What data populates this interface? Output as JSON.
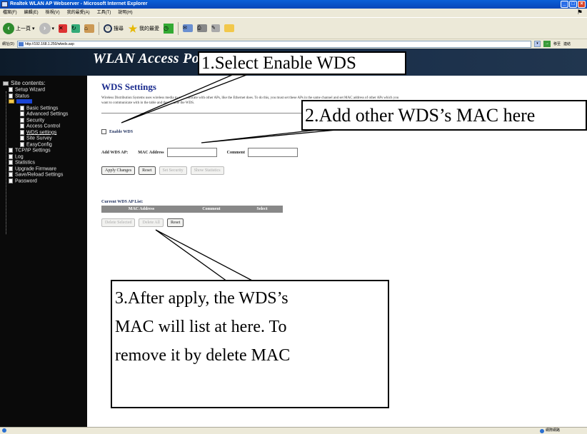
{
  "window": {
    "title": "Realtek WLAN AP Webserver - Microsoft Internet Explorer",
    "controls": {
      "minimize": "_",
      "maximize": "□",
      "close": "×"
    }
  },
  "menubar": {
    "items": [
      "檔案(F)",
      "編輯(E)",
      "檢視(V)",
      "我的最愛(A)",
      "工具(T)",
      "說明(H)"
    ]
  },
  "toolbar": {
    "back_label": "上一頁",
    "search_label": "搜尋",
    "favorites_label": "我的最愛",
    "icons": [
      "back-icon",
      "forward-icon",
      "stop-icon",
      "refresh-icon",
      "home-icon",
      "search-icon",
      "favorites-icon",
      "history-icon",
      "mail-icon",
      "print-icon",
      "edit-icon",
      "folder-icon"
    ]
  },
  "addressbar": {
    "label": "網址(D)",
    "url": "http://192.168.1.250/wlwds.asp",
    "go_label": "移至",
    "links_label": "連結"
  },
  "banner": {
    "title": "WLAN Access Point"
  },
  "sidebar": {
    "title": "Site contents:",
    "items": [
      {
        "label": "Setup Wizard",
        "level": 1,
        "icon": "doc"
      },
      {
        "label": "Status",
        "level": 1,
        "icon": "doc"
      },
      {
        "label": "",
        "level": 1,
        "icon": "folder"
      },
      {
        "label": "Basic Settings",
        "level": 2,
        "icon": "doc"
      },
      {
        "label": "Advanced Settings",
        "level": 2,
        "icon": "doc"
      },
      {
        "label": "Security",
        "level": 2,
        "icon": "doc"
      },
      {
        "label": "Access Control",
        "level": 2,
        "icon": "doc"
      },
      {
        "label": "WDS settings",
        "level": 2,
        "icon": "doc",
        "active": true
      },
      {
        "label": "Site Survey",
        "level": 2,
        "icon": "doc"
      },
      {
        "label": "EasyConfig",
        "level": 2,
        "icon": "doc"
      },
      {
        "label": "TCP/IP Settings",
        "level": 1,
        "icon": "doc"
      },
      {
        "label": "Log",
        "level": 1,
        "icon": "doc"
      },
      {
        "label": "Statistics",
        "level": 1,
        "icon": "doc"
      },
      {
        "label": "Upgrade Firmware",
        "level": 1,
        "icon": "doc"
      },
      {
        "label": "Save/Reload Settings",
        "level": 1,
        "icon": "doc"
      },
      {
        "label": "Password",
        "level": 1,
        "icon": "doc"
      }
    ]
  },
  "main": {
    "title": "WDS Settings",
    "description": "Wireless Distribution Systems uses wireless media to communicate with other APs, like the Ethernet does. To do this, you must set these APs in the same channel and set MAC address of other APs which you want to communicate with in the table and then enable the WDS.",
    "enable_label": "Enable WDS",
    "add_label": "Add WDS AP:",
    "mac_label": "MAC Address",
    "mac_value": "",
    "comment_label": "Comment",
    "comment_value": "",
    "buttons_row1": [
      "Apply Changes",
      "Reset",
      "Set Security",
      "Show Statistics"
    ],
    "list_title": "Current WDS AP List:",
    "table_headers": [
      "MAC Address",
      "Comment",
      "Select"
    ],
    "buttons_row2": [
      "Delete Selected",
      "Delete All",
      "Reset"
    ]
  },
  "callouts": {
    "c1": "1.Select Enable WDS",
    "c2": "2.Add other WDS’s MAC here",
    "c3_lines": [
      "3.After apply, the WDS’s",
      "MAC will list at here. To",
      "remove it by delete MAC"
    ]
  },
  "statusbar": {
    "zone_label": "網際網路"
  }
}
